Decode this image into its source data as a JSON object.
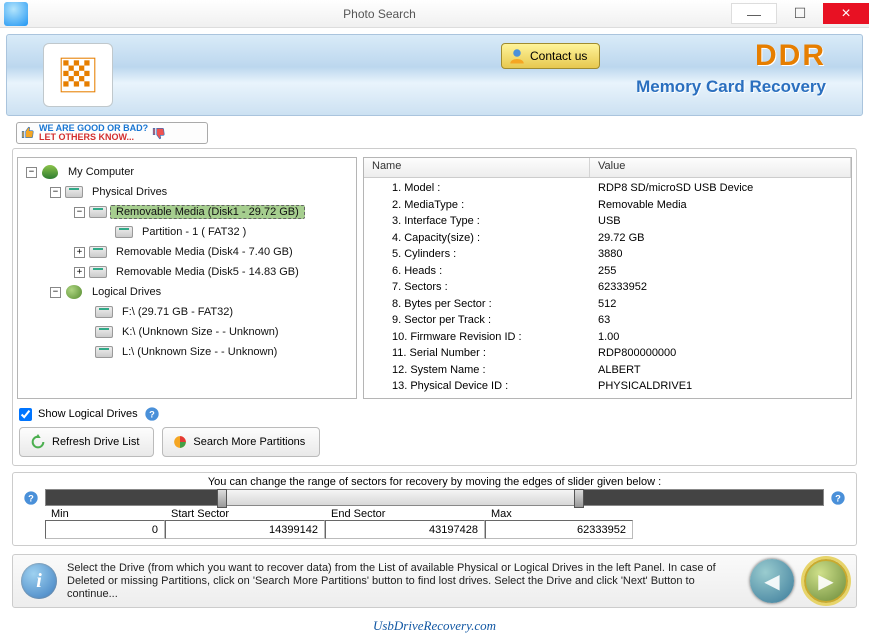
{
  "window": {
    "title": "Photo Search"
  },
  "header": {
    "contact": "Contact us",
    "brand": "DDR",
    "subtitle": "Memory Card Recovery",
    "feedback_line1": "WE ARE GOOD OR BAD?",
    "feedback_line2": "LET OTHERS KNOW..."
  },
  "tree": {
    "root": "My Computer",
    "physical_label": "Physical Drives",
    "items": [
      "Removable Media (Disk1 - 29.72 GB)",
      "Partition - 1 ( FAT32 )",
      "Removable Media (Disk4 - 7.40 GB)",
      "Removable Media (Disk5 - 14.83 GB)"
    ],
    "logical_label": "Logical Drives",
    "logical": [
      "F:\\ (29.71 GB  -  FAT32)",
      "K:\\ (Unknown Size  -  - Unknown)",
      "L:\\ (Unknown Size  -  - Unknown)"
    ]
  },
  "props": {
    "header_name": "Name",
    "header_value": "Value",
    "rows": [
      {
        "n": "1. Model :",
        "v": "RDP8 SD/microSD USB Device"
      },
      {
        "n": "2. MediaType :",
        "v": "Removable Media"
      },
      {
        "n": "3. Interface Type :",
        "v": "USB"
      },
      {
        "n": "4. Capacity(size) :",
        "v": "29.72 GB"
      },
      {
        "n": "5. Cylinders :",
        "v": "3880"
      },
      {
        "n": "6. Heads :",
        "v": "255"
      },
      {
        "n": "7. Sectors :",
        "v": "62333952"
      },
      {
        "n": "8. Bytes per Sector :",
        "v": "512"
      },
      {
        "n": "9. Sector per Track :",
        "v": "63"
      },
      {
        "n": "10. Firmware Revision ID :",
        "v": "1.00"
      },
      {
        "n": "11. Serial Number :",
        "v": "RDP800000000"
      },
      {
        "n": "12. System Name :",
        "v": "ALBERT"
      },
      {
        "n": "13. Physical Device ID :",
        "v": "PHYSICALDRIVE1"
      }
    ]
  },
  "controls": {
    "show_logical": "Show Logical Drives",
    "refresh": "Refresh Drive List",
    "search_more": "Search More Partitions"
  },
  "slider": {
    "note": "You can change the range of sectors for recovery by moving the edges of slider given below :",
    "min_label": "Min",
    "min": "0",
    "start_label": "Start Sector",
    "start": "14399142",
    "end_label": "End Sector",
    "end": "43197428",
    "max_label": "Max",
    "max": "62333952"
  },
  "footer": {
    "text": "Select the Drive (from which you want to recover data) from the List of available Physical or Logical Drives in the left Panel. In case of Deleted or missing Partitions, click on 'Search More Partitions' button to find lost drives. Select the Drive and click 'Next' Button to continue..."
  },
  "site": "UsbDriveRecovery.com"
}
